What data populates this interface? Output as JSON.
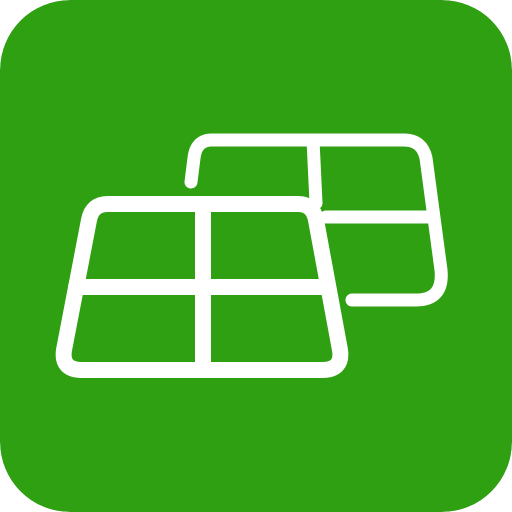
{
  "icon": {
    "name": "solar-panels-icon",
    "colors": {
      "background": "#2ea012",
      "foreground": "#ffffff"
    }
  }
}
